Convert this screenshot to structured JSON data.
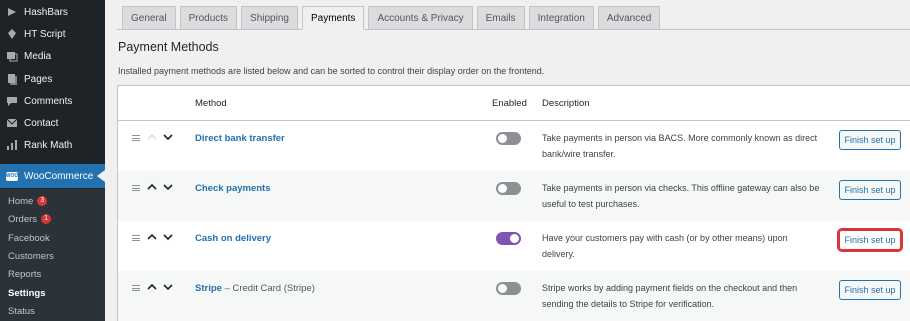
{
  "sidebar": {
    "items": [
      {
        "label": "HashBars",
        "icon": "hashbars-icon"
      },
      {
        "label": "HT Script",
        "icon": "script-icon"
      },
      {
        "label": "Media",
        "icon": "media-icon"
      },
      {
        "label": "Pages",
        "icon": "pages-icon"
      },
      {
        "label": "Comments",
        "icon": "comments-icon"
      },
      {
        "label": "Contact",
        "icon": "mail-icon"
      },
      {
        "label": "Rank Math",
        "icon": "rank-math-icon"
      }
    ],
    "woocommerce": {
      "label": "WooCommerce",
      "badge": "WOO"
    },
    "submenu": [
      {
        "label": "Home",
        "count": "3"
      },
      {
        "label": "Orders",
        "count": "1"
      },
      {
        "label": "Facebook"
      },
      {
        "label": "Customers"
      },
      {
        "label": "Reports"
      },
      {
        "label": "Settings",
        "current": true
      },
      {
        "label": "Status"
      }
    ]
  },
  "tabs": [
    "General",
    "Products",
    "Shipping",
    "Payments",
    "Accounts & Privacy",
    "Emails",
    "Integration",
    "Advanced"
  ],
  "active_tab": "Payments",
  "page": {
    "title": "Payment Methods",
    "description": "Installed payment methods are listed below and can be sorted to control their display order on the frontend."
  },
  "table": {
    "headers": {
      "method": "Method",
      "enabled": "Enabled",
      "description": "Description"
    },
    "rows": [
      {
        "name": "Direct bank transfer",
        "sub": "",
        "enabled": false,
        "description": "Take payments in person via BACS. More commonly known as direct bank/wire transfer.",
        "button": "Finish set up",
        "highlight": false
      },
      {
        "name": "Check payments",
        "sub": "",
        "enabled": false,
        "description": "Take payments in person via checks. This offline gateway can also be useful to test purchases.",
        "button": "Finish set up",
        "highlight": false
      },
      {
        "name": "Cash on delivery",
        "sub": "",
        "enabled": true,
        "description": "Have your customers pay with cash (or by other means) upon delivery.",
        "button": "Finish set up",
        "highlight": true
      },
      {
        "name": "Stripe",
        "sub": " – Credit Card (Stripe)",
        "enabled": false,
        "description": "Stripe works by adding payment fields on the checkout and then sending the details to Stripe for verification.",
        "button": "Finish set up",
        "highlight": false
      }
    ]
  },
  "colors": {
    "accent": "#2271b1",
    "sidebar": "#1d2327",
    "toggle_on": "#7f54b3",
    "highlight": "#d63638"
  }
}
